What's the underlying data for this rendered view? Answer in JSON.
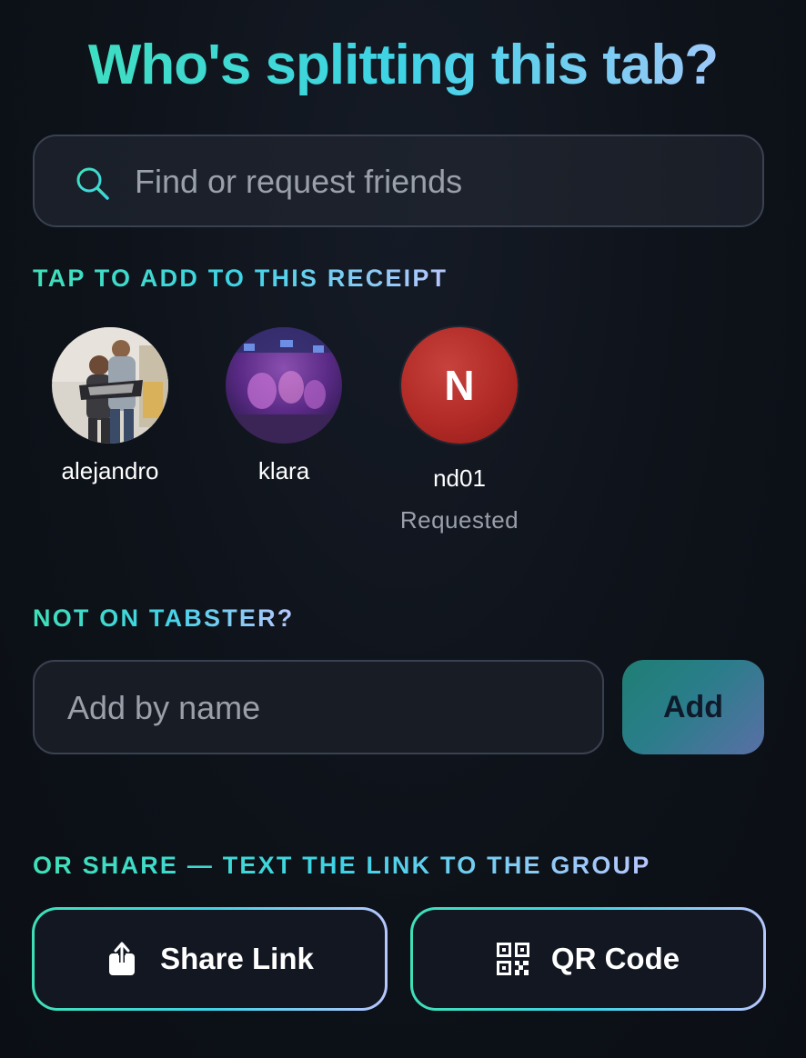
{
  "header": {
    "title": "Who's splitting this tab?"
  },
  "search": {
    "placeholder": "Find or request friends",
    "icon": "search-icon"
  },
  "friends_section": {
    "label": "TAP TO ADD TO THIS RECEIPT",
    "friends": [
      {
        "name": "alejandro",
        "avatar": "photo",
        "status": ""
      },
      {
        "name": "klara",
        "avatar": "photo",
        "status": ""
      },
      {
        "name": "nd01",
        "avatar": "letter",
        "letter": "N",
        "status": "Requested"
      }
    ]
  },
  "not_on_app": {
    "label": "NOT ON TABSTER?",
    "name_placeholder": "Add by name",
    "add_label": "Add"
  },
  "share_section": {
    "label": "OR SHARE — TEXT THE LINK TO THE GROUP",
    "share_link_label": "Share Link",
    "qr_code_label": "QR Code",
    "share_icon": "share-icon",
    "qr_icon": "qr-code-icon"
  },
  "colors": {
    "background": "#0d1118",
    "accent_start": "#3fe0b8",
    "accent_mid": "#3fd3e6",
    "accent_end": "#b7c6ff",
    "avatar_red": "#b12a26",
    "muted_text": "#9aa0aa"
  }
}
